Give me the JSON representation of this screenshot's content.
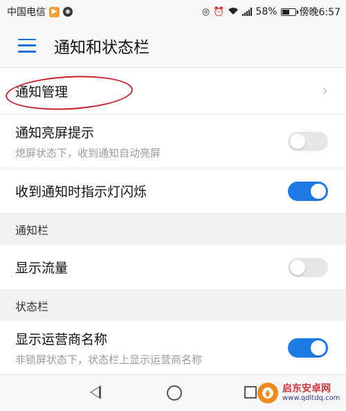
{
  "status_bar": {
    "carrier": "中国电信",
    "battery_percent": "58%",
    "battery_level": 0.58,
    "time": "傍晚6:57"
  },
  "header": {
    "title": "通知和状态栏"
  },
  "settings": {
    "notification_management": {
      "title": "通知管理"
    },
    "wake_screen": {
      "title": "通知亮屏提示",
      "subtitle": "熄屏状态下，收到通知自动亮屏",
      "enabled": false
    },
    "indicator_light": {
      "title": "收到通知时指示灯闪烁",
      "enabled": true
    },
    "notification_bar_section": "通知栏",
    "show_traffic": {
      "title": "显示流量",
      "enabled": false
    },
    "status_bar_section": "状态栏",
    "show_carrier": {
      "title": "显示运营商名称",
      "subtitle": "非锁屏状态下，状态栏上显示运营商名称",
      "enabled": true
    }
  },
  "watermark": {
    "name": "启东安卓网",
    "url": "www.qdltdq.com"
  },
  "colors": {
    "accent": "#1e7be6",
    "annotation": "#c8202a"
  },
  "icons": {
    "menu": "menu-icon",
    "chevron": "chevron-right-icon",
    "back": "back-icon",
    "home": "home-icon",
    "recent": "recent-apps-icon"
  }
}
